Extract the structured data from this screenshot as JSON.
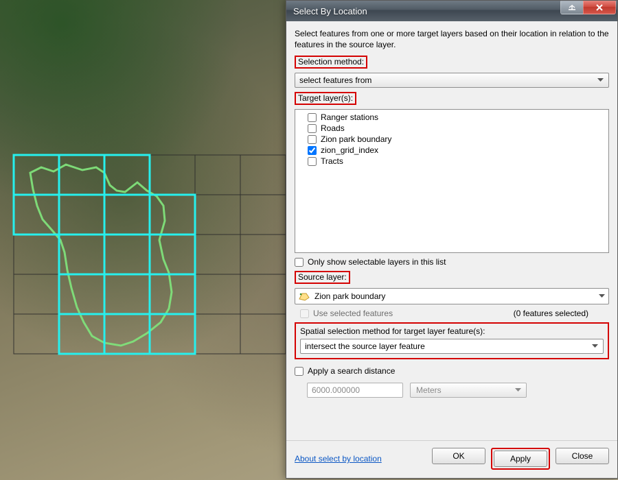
{
  "window": {
    "title": "Select By Location"
  },
  "intro": "Select features from one or more target layers based on their location in relation to the features in the source layer.",
  "labels": {
    "selection_method": "Selection method:",
    "target_layers": "Target layer(s):",
    "only_selectable": "Only show selectable layers in this list",
    "source_layer": "Source layer:",
    "use_selected": "Use selected features",
    "features_selected": "(0 features selected)",
    "spatial_method": "Spatial selection method for target layer feature(s):",
    "apply_distance": "Apply a search distance"
  },
  "selection_method": {
    "value": "select features from"
  },
  "target_layers": [
    {
      "label": "Ranger stations",
      "checked": false
    },
    {
      "label": "Roads",
      "checked": false
    },
    {
      "label": "Zion park boundary",
      "checked": false
    },
    {
      "label": "zion_grid_index",
      "checked": true
    },
    {
      "label": "Tracts",
      "checked": false
    }
  ],
  "only_selectable_checked": false,
  "source_layer": {
    "value": "Zion park boundary"
  },
  "use_selected_checked": false,
  "spatial_method": {
    "value": "intersect the source layer feature"
  },
  "search_distance": {
    "checked": false,
    "value": "6000.000000",
    "unit": "Meters"
  },
  "footer": {
    "about": "About select by location",
    "ok": "OK",
    "apply": "Apply",
    "close": "Close"
  }
}
